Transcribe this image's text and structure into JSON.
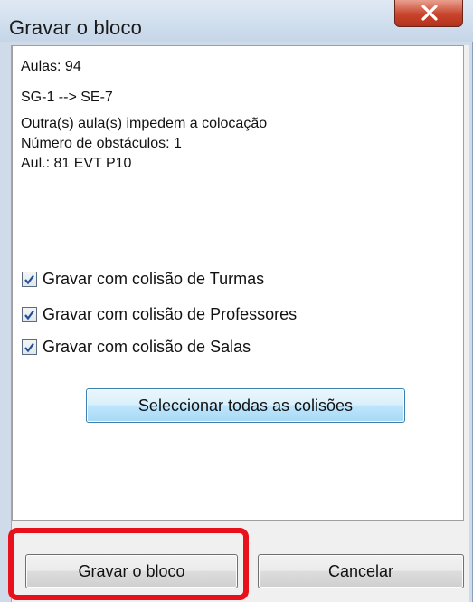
{
  "window": {
    "title": "Gravar o bloco",
    "close_label": "X"
  },
  "info": {
    "lessons": "Aulas: 94",
    "move": "SG-1 --> SE-7",
    "reason": "Outra(s) aula(s) impedem a colocação",
    "obstacles": "Número de obstáculos: 1",
    "conflict_lesson": "Aul.: 81 EVT P10"
  },
  "options": [
    {
      "label": "Gravar com colisão de Turmas",
      "checked": true
    },
    {
      "label": "Gravar com colisão de Professores",
      "checked": true
    },
    {
      "label": "Gravar com colisão de Salas",
      "checked": true
    }
  ],
  "buttons": {
    "select_all": "Seleccionar todas as colisões",
    "save_block": "Gravar o bloco",
    "cancel": "Cancelar"
  },
  "colors": {
    "highlight": "#e8101b",
    "close_button": "#c8442c",
    "primary_button": "#bee6fd"
  }
}
